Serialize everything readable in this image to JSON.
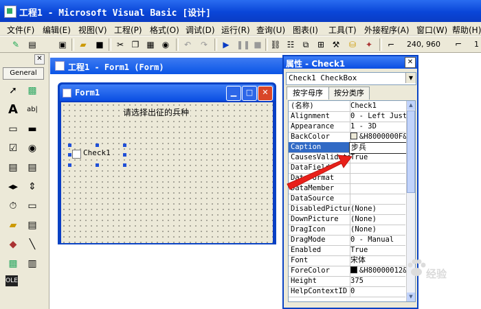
{
  "window": {
    "title": "工程1 - Microsoft Visual Basic [设计]"
  },
  "menu": [
    "文件(F)",
    "编辑(E)",
    "视图(V)",
    "工程(P)",
    "格式(O)",
    "调试(D)",
    "运行(R)",
    "查询(U)",
    "图表(I)",
    "工具(T)",
    "外接程序(A)",
    "窗口(W)",
    "帮助(H)"
  ],
  "toolbar": {
    "coords": "240, 960",
    "size_partial": "1"
  },
  "toolbox": {
    "tab": "General"
  },
  "project_window": {
    "title": "工程1 - Form1 (Form)"
  },
  "form": {
    "title": "Form1",
    "label_text": "请选择出征的兵种",
    "checkbox_caption": "Check1"
  },
  "properties": {
    "title": "属性 - Check1",
    "object": "Check1 CheckBox",
    "tabs": [
      "按字母序",
      "按分类序"
    ],
    "rows": [
      {
        "name": "(名称)",
        "value": "Check1"
      },
      {
        "name": "Alignment",
        "value": "0 - Left Justi"
      },
      {
        "name": "Appearance",
        "value": "1 - 3D"
      },
      {
        "name": "BackColor",
        "value": "&H8000000F&"
      },
      {
        "name": "Caption",
        "value": "步兵"
      },
      {
        "name": "CausesValidation",
        "value": "True"
      },
      {
        "name": "DataField",
        "value": ""
      },
      {
        "name": "DataFormat",
        "value": ""
      },
      {
        "name": "DataMember",
        "value": ""
      },
      {
        "name": "DataSource",
        "value": ""
      },
      {
        "name": "DisabledPicture",
        "value": "(None)"
      },
      {
        "name": "DownPicture",
        "value": "(None)"
      },
      {
        "name": "DragIcon",
        "value": "(None)"
      },
      {
        "name": "DragMode",
        "value": "0 - Manual"
      },
      {
        "name": "Enabled",
        "value": "True"
      },
      {
        "name": "Font",
        "value": "宋体"
      },
      {
        "name": "ForeColor",
        "value": "&H80000012&"
      },
      {
        "name": "Height",
        "value": "375"
      },
      {
        "name": "HelpContextID",
        "value": "0"
      }
    ],
    "selected_row": "Caption"
  },
  "watermark": {
    "text": "经验"
  },
  "colors": {
    "titlebar": "#0a46d8",
    "selection": "#316ac5",
    "arrow": "#e8201a",
    "form_back": "#ece9d8"
  }
}
